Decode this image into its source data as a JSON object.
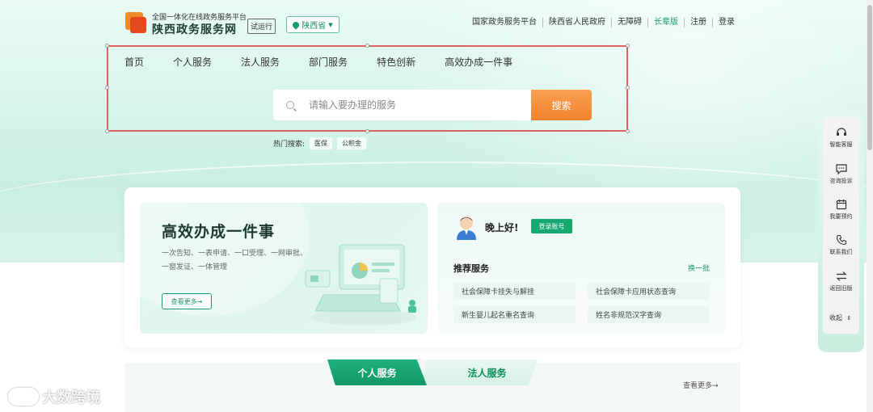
{
  "header": {
    "site_subtitle": "全国一体化在线政务服务平台",
    "site_title": "陕西政务服务网",
    "trial_badge": "试运行",
    "province": "陕西省",
    "links": [
      {
        "label": "国家政务服务平台"
      },
      {
        "label": "陕西省人民政府"
      },
      {
        "label": "无障碍"
      },
      {
        "label": "长辈版"
      },
      {
        "label": "注册"
      },
      {
        "label": "登录"
      }
    ],
    "accent_color": "#1a9a66"
  },
  "nav": {
    "items": [
      "首页",
      "个人服务",
      "法人服务",
      "部门服务",
      "特色创新",
      "高效办成一件事"
    ]
  },
  "search": {
    "placeholder": "请输入要办理的服务",
    "button_label": "搜索",
    "hot_label": "热门搜索:",
    "hot_tags": [
      "医保",
      "公积金"
    ]
  },
  "feature": {
    "title": "高效办成一件事",
    "description": "一次告知、一表申请、一口受理、一网审批、一窗发证、一体管理",
    "more_label": "查看更多→"
  },
  "user_panel": {
    "greeting": "晚上好!",
    "login_label": "登录账号",
    "recommend_title": "推荐服务",
    "refresh_label": "换一批",
    "services": [
      "社会保障卡挂失与解挂",
      "社会保障卡应用状态查询",
      "新生婴儿起名重名查询",
      "姓名非规范汉字查询"
    ]
  },
  "bottom": {
    "tab_active": "个人服务",
    "tab_inactive": "法人服务",
    "more_label": "查看更多→"
  },
  "float_bar": {
    "items": [
      {
        "label": "智能客服",
        "icon": "headset-icon"
      },
      {
        "label": "咨询投诉",
        "icon": "message-icon"
      },
      {
        "label": "我要预约",
        "icon": "calendar-icon"
      },
      {
        "label": "联系我们",
        "icon": "phone-icon"
      },
      {
        "label": "返回旧版",
        "icon": "switch-icon"
      }
    ],
    "collapse_label": "收起"
  },
  "watermark": {
    "text": "大数跨境"
  }
}
